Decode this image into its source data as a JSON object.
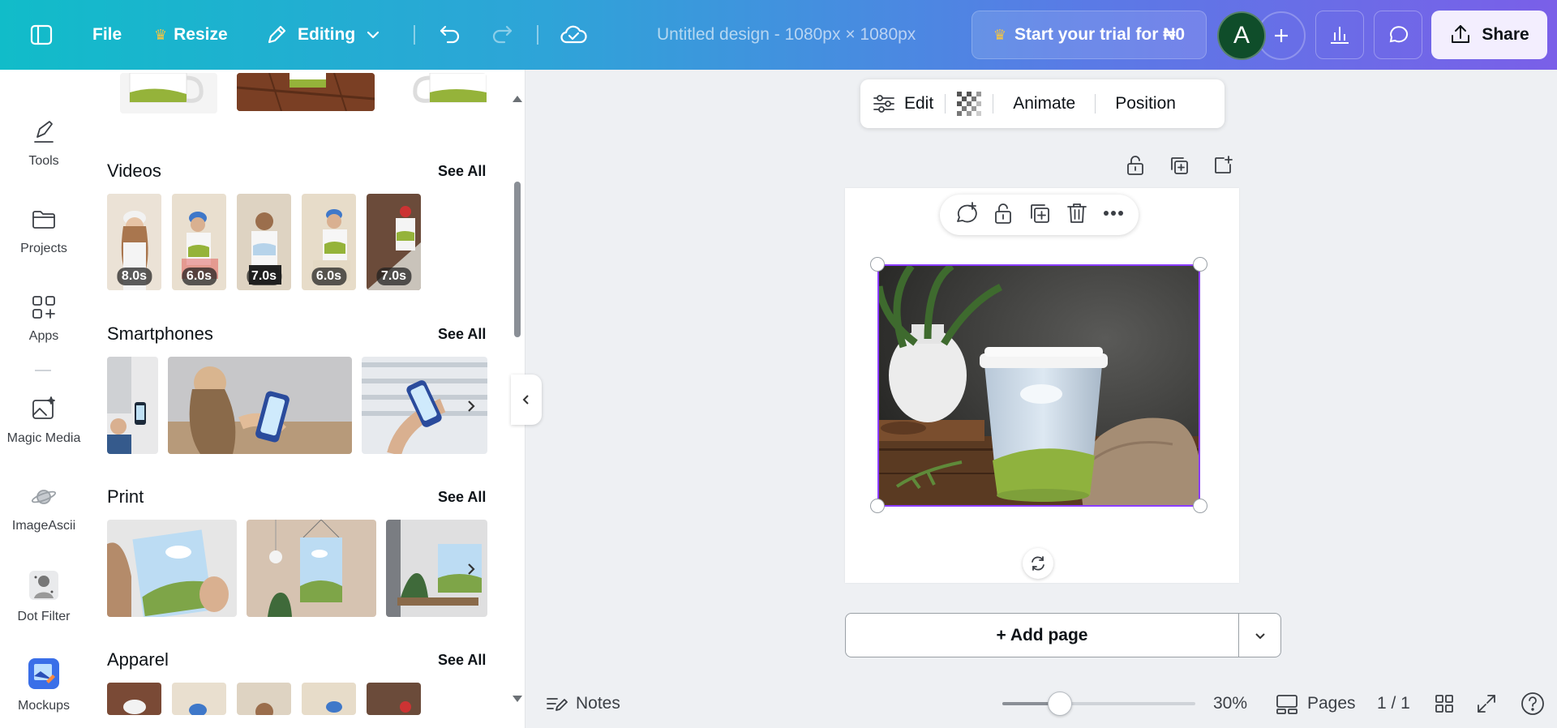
{
  "topbar": {
    "file_label": "File",
    "resize_label": "Resize",
    "editing_label": "Editing",
    "doc_title": "Untitled design - 1080px × 1080px",
    "trial_label": "Start your trial for ₦0",
    "avatar_initial": "A",
    "share_label": "Share"
  },
  "rail": {
    "items": [
      {
        "label": "Tools",
        "icon": "pen-tool-icon"
      },
      {
        "label": "Projects",
        "icon": "folder-icon"
      },
      {
        "label": "Apps",
        "icon": "apps-grid-icon"
      },
      {
        "label": "Magic Media",
        "icon": "magic-image-icon"
      },
      {
        "label": "ImageAscii",
        "icon": "planet-icon"
      },
      {
        "label": "Dot Filter",
        "icon": "dot-filter-icon"
      },
      {
        "label": "Mockups",
        "icon": "mockups-icon"
      }
    ]
  },
  "panel": {
    "see_all": "See All",
    "sections": [
      {
        "title": "Videos"
      },
      {
        "title": "Smartphones"
      },
      {
        "title": "Print"
      },
      {
        "title": "Apparel"
      }
    ],
    "videos": [
      "8.0s",
      "6.0s",
      "7.0s",
      "6.0s",
      "7.0s"
    ]
  },
  "context_toolbar": {
    "edit_label": "Edit",
    "animate_label": "Animate",
    "position_label": "Position"
  },
  "canvas": {
    "add_page_label": "+ Add page"
  },
  "bottombar": {
    "notes_label": "Notes",
    "zoom_value": "30%",
    "zoom_fraction": 0.3,
    "pages_label": "Pages",
    "page_count": "1 / 1"
  },
  "colors": {
    "selection": "#8b3dff",
    "avatar_bg": "#0f4d2a",
    "share_bg": "#f3eefe"
  }
}
